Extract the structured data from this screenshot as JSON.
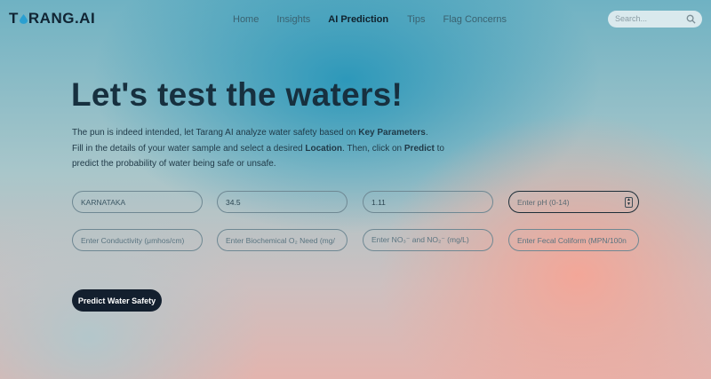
{
  "nav": {
    "logo_part1": "T",
    "logo_part2": "RANG.AI",
    "links": [
      {
        "label": "Home",
        "active": false
      },
      {
        "label": "Insights",
        "active": false
      },
      {
        "label": "AI Prediction",
        "active": true
      },
      {
        "label": "Tips",
        "active": false
      },
      {
        "label": "Flag Concerns",
        "active": false
      }
    ],
    "search_placeholder": "Search..."
  },
  "hero": {
    "title": "Let's test the waters!",
    "p1_a": "The pun is indeed intended, let Tarang AI analyze water safety based on ",
    "p1_b": "Key Parameters",
    "p1_c": ".",
    "p2_a": "Fill in the details of your water sample and select a desired ",
    "p2_b": "Location",
    "p2_c": ". Then, click on ",
    "p2_d": "Predict",
    "p2_e": " to",
    "p3": "predict the probability of water being safe or unsafe."
  },
  "form": {
    "location": "KARNATAKA",
    "field2_value": "34.5",
    "field3_value": "1.11",
    "ph_placeholder": "Enter pH (0-14)",
    "conductivity_placeholder": "Enter Conductivity (μmhos/cm)",
    "bod_placeholder": "Enter Biochemical O₂ Need (mg/",
    "nitrate_placeholder": "Enter NO₃⁻ and NO₂⁻ (mg/L)",
    "coliform_placeholder": "Enter Fecal Coliform (MPN/100n",
    "submit_label": "Predict Water Safety"
  },
  "colors": {
    "accent_dark": "#131f2e",
    "logo_drop": "#2a9fd0"
  }
}
